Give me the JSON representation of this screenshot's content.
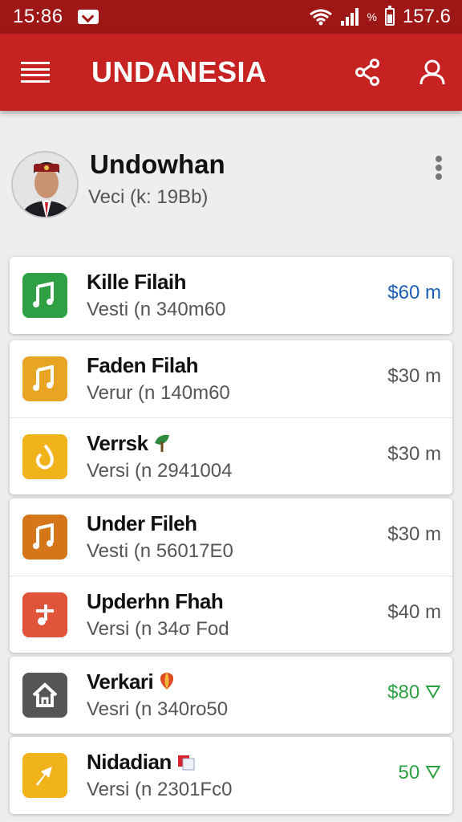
{
  "status_bar": {
    "time": "15:86",
    "mail_icon": "mail-icon",
    "pct_label": "%",
    "battery_level": "157.6"
  },
  "app_bar": {
    "title": "UNDANESIA",
    "menu_icon": "menu-icon",
    "share_icon": "share-icon",
    "account_icon": "account-icon"
  },
  "profile": {
    "name": "Undowhan",
    "subtitle": "Veci  (k: 19Bb)",
    "more_icon": "more-vert-icon"
  },
  "cards": [
    [
      {
        "title": "Kille Filaih",
        "subtitle": "Vesti (n 340m60",
        "price": "$60 m",
        "icon": "music-note-icon",
        "icon_color": "#2ea043",
        "price_color": "#1a5fb4"
      }
    ],
    [
      {
        "title": "Faden Filah",
        "subtitle": "Verur (n 140m60",
        "price": "$30 m",
        "icon": "music-note-icon",
        "icon_color": "#e8a524",
        "price_color": "#555555"
      },
      {
        "title": "Verrsk",
        "subtitle": "Versi (n 2941004",
        "price": "$30 m",
        "icon": "flame-icon",
        "icon_color": "#f0b31a",
        "price_color": "#555555",
        "emoji": "leaf-emoji"
      }
    ],
    [
      {
        "title": "Under Fileh",
        "subtitle": "Vesti (n 56017E0",
        "price": "$30 m",
        "icon": "music-note-icon",
        "icon_color": "#d6761a",
        "price_color": "#555555"
      },
      {
        "title": "Upderhn Fhah",
        "subtitle": "Versi (n 34σ Fod",
        "price": "$40 m",
        "icon": "music-note-icon",
        "icon_color": "#e0543a",
        "price_color": "#555555"
      }
    ],
    [
      {
        "title": "Verkari",
        "subtitle": "Vesri (n 340ro50",
        "price": "$80 ⛛",
        "icon": "home-icon",
        "icon_color": "#555555",
        "price_color": "#2ea043",
        "emoji": "balloon-emoji"
      }
    ],
    [
      {
        "title": "Nidadian",
        "subtitle": "Versi (n 2301Fc0",
        "price": "50 ⛛",
        "icon": "plane-icon",
        "icon_color": "#f0b31a",
        "price_color": "#2ea043",
        "emoji": "flag-emoji"
      }
    ]
  ]
}
